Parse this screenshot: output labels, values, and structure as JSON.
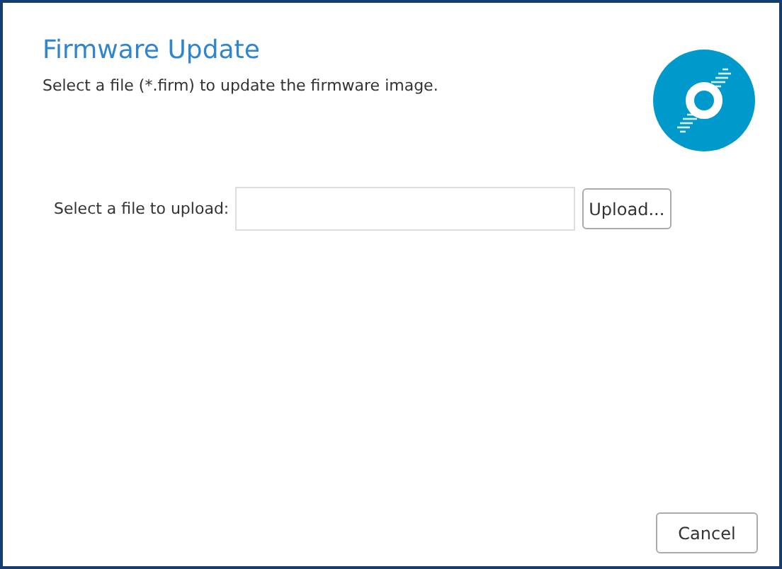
{
  "dialog": {
    "title": "Firmware Update",
    "description": "Select a file (*.firm) to update the firmware image."
  },
  "upload": {
    "label": "Select a file to upload:",
    "button": "Upload..."
  },
  "buttons": [
    "Cancel"
  ]
}
